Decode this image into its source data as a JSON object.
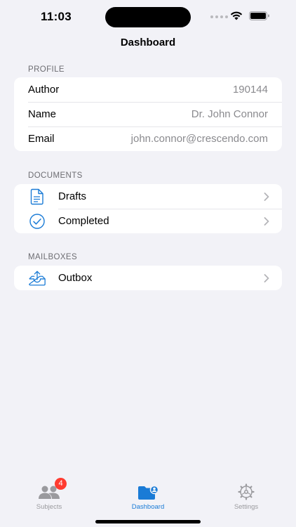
{
  "status_bar": {
    "time": "11:03"
  },
  "nav": {
    "title": "Dashboard"
  },
  "profile": {
    "header": "PROFILE",
    "rows": [
      {
        "label": "Author",
        "value": "190144"
      },
      {
        "label": "Name",
        "value": "Dr. John Connor"
      },
      {
        "label": "Email",
        "value": "john.connor@crescendo.com"
      }
    ]
  },
  "documents": {
    "header": "DOCUMENTS",
    "items": [
      {
        "label": "Drafts",
        "icon": "document-icon"
      },
      {
        "label": "Completed",
        "icon": "checkmark-circle-icon"
      }
    ]
  },
  "mailboxes": {
    "header": "MAILBOXES",
    "items": [
      {
        "label": "Outbox",
        "icon": "outbox-tray-icon"
      }
    ]
  },
  "tab_bar": {
    "tabs": [
      {
        "label": "Subjects",
        "icon": "people-icon",
        "badge": "4",
        "active": false
      },
      {
        "label": "Dashboard",
        "icon": "folder-person-icon",
        "active": true
      },
      {
        "label": "Settings",
        "icon": "gear-icon",
        "active": false
      }
    ]
  },
  "colors": {
    "accent": "#1a7bd6",
    "badge": "#ff3b30",
    "background": "#f2f2f7"
  }
}
